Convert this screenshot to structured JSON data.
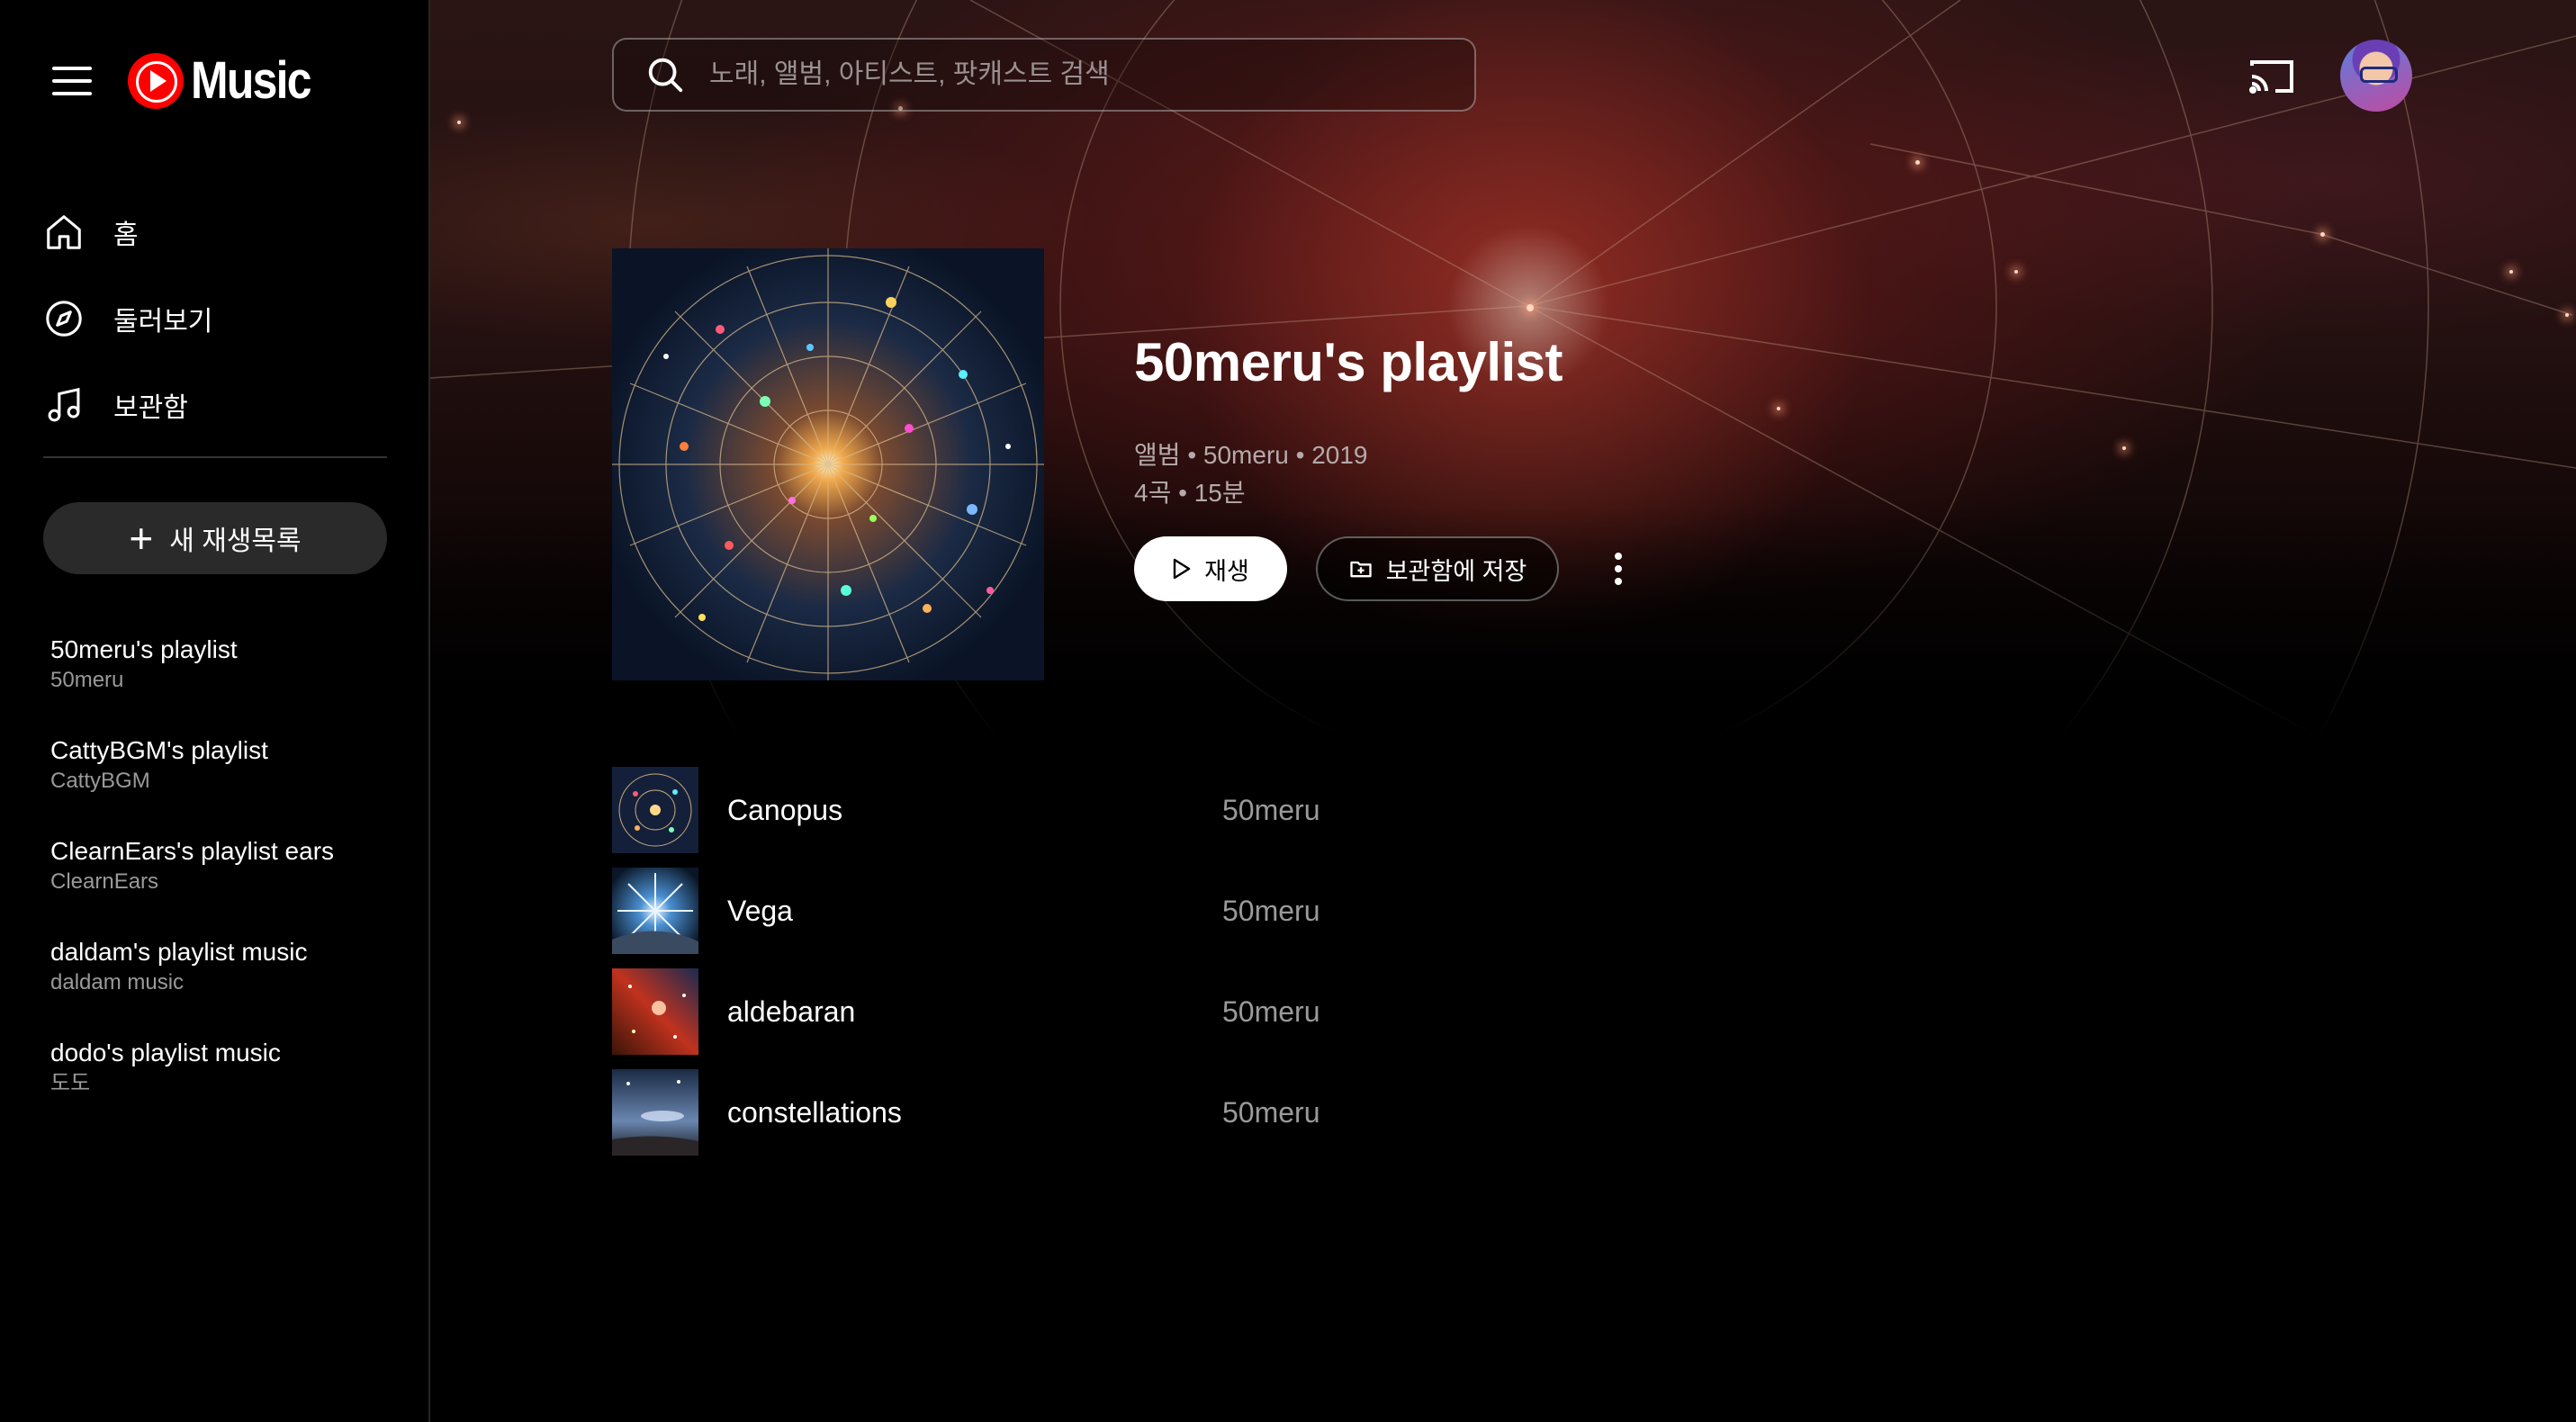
{
  "app": {
    "logo_text": "Music",
    "brand_color": "#ff0000"
  },
  "nav": {
    "items": [
      {
        "label": "홈",
        "icon": "home-icon"
      },
      {
        "label": "둘러보기",
        "icon": "explore-icon"
      },
      {
        "label": "보관함",
        "icon": "library-music-icon"
      }
    ]
  },
  "sidebar": {
    "new_playlist_label": "새 재생목록",
    "playlists": [
      {
        "title": "50meru's playlist",
        "subtitle": "50meru"
      },
      {
        "title": "CattyBGM's playlist",
        "subtitle": "CattyBGM"
      },
      {
        "title": "ClearnEars's playlist ears",
        "subtitle": "ClearnEars"
      },
      {
        "title": "daldam's playlist music",
        "subtitle": "daldam music"
      },
      {
        "title": "dodo's playlist music",
        "subtitle": "도도"
      }
    ]
  },
  "search": {
    "placeholder": "노래, 앨범, 아티스트, 팟캐스트 검색"
  },
  "album": {
    "title": "50meru's playlist",
    "type": "앨범",
    "artist": "50meru",
    "year": "2019",
    "track_count": "4곡",
    "duration": "15분",
    "play_label": "재생",
    "save_label": "보관함에 저장"
  },
  "tracks": [
    {
      "title": "Canopus",
      "artist": "50meru"
    },
    {
      "title": "Vega",
      "artist": "50meru"
    },
    {
      "title": "aldebaran",
      "artist": "50meru"
    },
    {
      "title": "constellations",
      "artist": "50meru"
    }
  ]
}
